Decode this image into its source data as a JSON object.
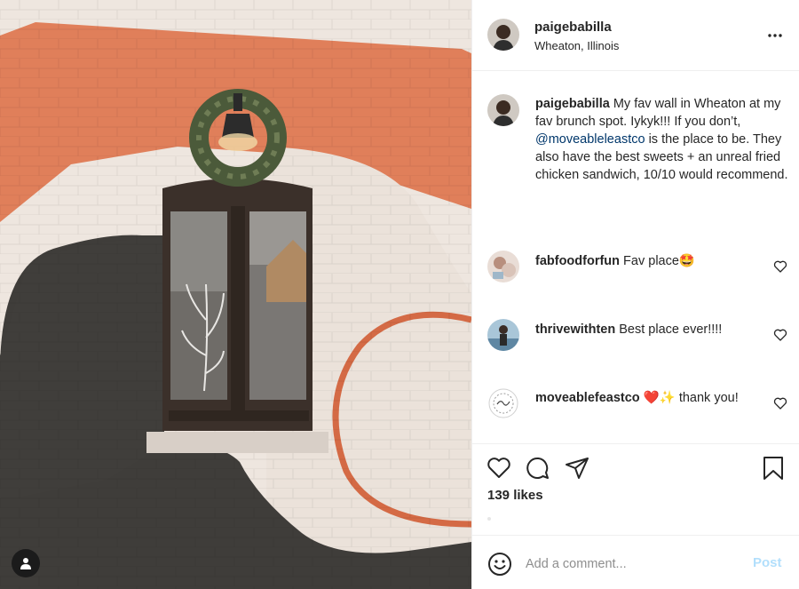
{
  "post": {
    "username": "paigebabilla",
    "location": "Wheaton, Illinois",
    "caption_user": "paigebabilla",
    "caption_before": " My fav wall in Wheaton at my fav brunch spot. Iykyk!!! If you don’t, ",
    "caption_mention": "@moveableleastco",
    "caption_after": " is the place to be. They also have the best sweets + an unreal fried chicken sandwich, 10/10 would recommend."
  },
  "comments": [
    {
      "user": "fabfoodforfun",
      "text": " Fav place🤩"
    },
    {
      "user": "thrivewithten",
      "text": " Best place ever!!!!"
    },
    {
      "user": "moveablefeastco",
      "text": " ❤️✨ thank you!"
    }
  ],
  "actions": {
    "likes": "139 likes"
  },
  "add_comment": {
    "placeholder": "Add a comment...",
    "post_label": "Post"
  },
  "icons": {
    "more": "more-options-icon",
    "like": "heart-icon",
    "comment": "comment-icon",
    "share": "paper-plane-icon",
    "save": "bookmark-icon",
    "emoji": "smiley-icon",
    "user_tag": "person-icon"
  },
  "colors": {
    "mention": "#00376b",
    "post_disabled": "#b2dffc",
    "mural_orange": "#e07f5a",
    "mural_dark": "#3f3d3a",
    "mural_cream": "#eee6df"
  }
}
